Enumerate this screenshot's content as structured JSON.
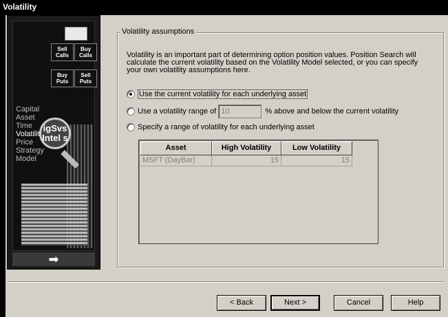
{
  "window": {
    "title": "Volatility"
  },
  "sidepanel": {
    "puzzle": [
      {
        "label": "Sell Calls"
      },
      {
        "label": "Buy Calls"
      },
      {
        "label": "Buy Puts"
      },
      {
        "label": "Sell Puts"
      }
    ],
    "menu": [
      "Capital",
      "Asset",
      "Time",
      "Volatility",
      "Price",
      "Strategy",
      "Model"
    ],
    "active_item": "Volatility",
    "logo_text": "igSvs Intel s",
    "next_arrow": "➡"
  },
  "group": {
    "legend": "Volatility assumptions",
    "description": "Volatility is an important part of determining option position values.  Position Search will calculate the current volatility based on the Volatility Model selected, or you can specify your own volatility assumptions here.",
    "options": {
      "current": {
        "label": "Use the current volatility for each underlying asset",
        "checked": true
      },
      "range": {
        "label_before": "Use a volatility range of",
        "value": "10",
        "label_after": "% above and below the current volatility",
        "checked": false
      },
      "specify": {
        "label": "Specify a range of volatility for each underlying asset",
        "checked": false
      }
    }
  },
  "table": {
    "columns": [
      "Asset",
      "High Volatility",
      "Low Volatility"
    ],
    "rows": [
      {
        "asset": "MSFT (DayBar)",
        "high": "15",
        "low": "15"
      }
    ]
  },
  "buttons": {
    "back": "< Back",
    "next": "Next >",
    "cancel": "Cancel",
    "help": "Help"
  }
}
